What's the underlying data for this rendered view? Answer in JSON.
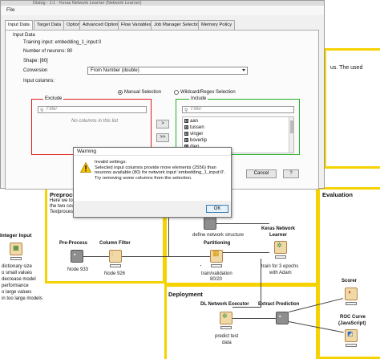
{
  "dialog": {
    "title": "Dialog - 1:1 - Keras Network Learner (Network Learner)",
    "menu": {
      "file": "File"
    },
    "tabs": [
      {
        "label": "Input Data"
      },
      {
        "label": "Target Data"
      },
      {
        "label": "Options"
      },
      {
        "label": "Advanced Options"
      },
      {
        "label": "Flow Variables"
      },
      {
        "label": "Job Manager Selection"
      },
      {
        "label": "Memory Policy"
      }
    ],
    "group_title": "Input Data",
    "training_input": "Training input: embedding_1_input:0",
    "neurons": "Number of neurons: 80",
    "shape": "Shape: [80]",
    "conversion_label": "Conversion",
    "conversion_value": "From Number (double)",
    "input_columns_label": "Input columns:",
    "radio_manual": "Manual Selection",
    "radio_wildcard": "Wildcard/Regex Selection",
    "exclude": {
      "title": "Exclude",
      "filter_placeholder": "Filter",
      "empty_text": "No columns in this list"
    },
    "include": {
      "title": "Include",
      "filter_placeholder": "Filter",
      "items": [
        "aan",
        "tussen",
        "vinger",
        "boverlip",
        "diep"
      ]
    },
    "move_buttons": [
      ">",
      ">>"
    ],
    "cancel_label": "Cancel"
  },
  "warning": {
    "title": "Warning",
    "message": "Invalid settings:\nSelected input columns provide more elements (2556) than neurons available (80) for network input 'embedding_1_input:0'. Try removing some columns from the selection.",
    "ok_label": "OK"
  },
  "workflow": {
    "preprocessing": {
      "title": "Preproce",
      "lines": [
        "Here we lo",
        "the two cou",
        "Textprocess"
      ]
    },
    "evaluation_title": "Evaluation",
    "deployment_title": "Deployment",
    "right_text_fragment": "us. The used",
    "left_annotation": {
      "title": "Integer Input",
      "lines": [
        "dictionary size",
        "o small values",
        "decrease model",
        "performance",
        "o large values",
        "in too large models"
      ]
    },
    "nodes": {
      "preprocess": {
        "label": "Pre-Process",
        "sub": "Node 933"
      },
      "column_filter": {
        "label": "Column Filter",
        "sub": "Node 926"
      },
      "network_structure": {
        "sub": "define network structure"
      },
      "partitioning": {
        "label": "Partitioning",
        "sub": "train/validation\n80/20"
      },
      "keras_learner": {
        "label": "Keras Network\nLearner",
        "sub": "train for 3 epochs\nwith Adam"
      },
      "executor": {
        "label": "DL Network Executor",
        "sub": "predict test\ndata"
      },
      "extract": {
        "label": "Extract Prediction"
      },
      "scorer": {
        "label": "Scorer"
      },
      "roc": {
        "label": "ROC Curve\n(JavaScript)"
      }
    }
  },
  "colors": {
    "annotation_yellow": "#f5d200",
    "exclude_border": "#e01c1c",
    "include_border": "#22b022"
  }
}
